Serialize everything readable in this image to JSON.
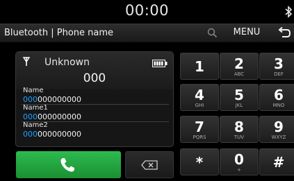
{
  "status": {
    "time": "00:00",
    "bluetooth_icon": "bluetooth-icon"
  },
  "header": {
    "title": "Bluetooth | Phone name",
    "search_icon": "search-icon",
    "menu_label": "MENU",
    "back_icon": "back-arrow-icon"
  },
  "caller": {
    "name": "Unknown",
    "number": "000",
    "signal_icon": "antenna-signal-icon",
    "battery_icon": "battery-icon"
  },
  "entries": [
    {
      "label": "Name",
      "match": "000",
      "rest": "000000000"
    },
    {
      "label": "Name1",
      "match": "000",
      "rest": "000000000"
    },
    {
      "label": "Name2",
      "match": "000",
      "rest": "000000000"
    }
  ],
  "keypad": {
    "keys": [
      {
        "digit": "1",
        "letters": ""
      },
      {
        "digit": "2",
        "letters": "ABC"
      },
      {
        "digit": "3",
        "letters": "DEF"
      },
      {
        "digit": "4",
        "letters": "GHI"
      },
      {
        "digit": "5",
        "letters": "JKL"
      },
      {
        "digit": "6",
        "letters": "MNO"
      },
      {
        "digit": "7",
        "letters": "PQRS"
      },
      {
        "digit": "8",
        "letters": "TUV"
      },
      {
        "digit": "9",
        "letters": "WXYZ"
      },
      {
        "digit": "*",
        "letters": ""
      },
      {
        "digit": "0",
        "letters": "+"
      },
      {
        "digit": "#",
        "letters": ""
      }
    ]
  },
  "actions": {
    "call_icon": "phone-handset-icon",
    "delete_icon": "backspace-icon"
  },
  "colors": {
    "call_green": "#22a844",
    "match_highlight": "#1fa0ff",
    "background": "#000000"
  }
}
